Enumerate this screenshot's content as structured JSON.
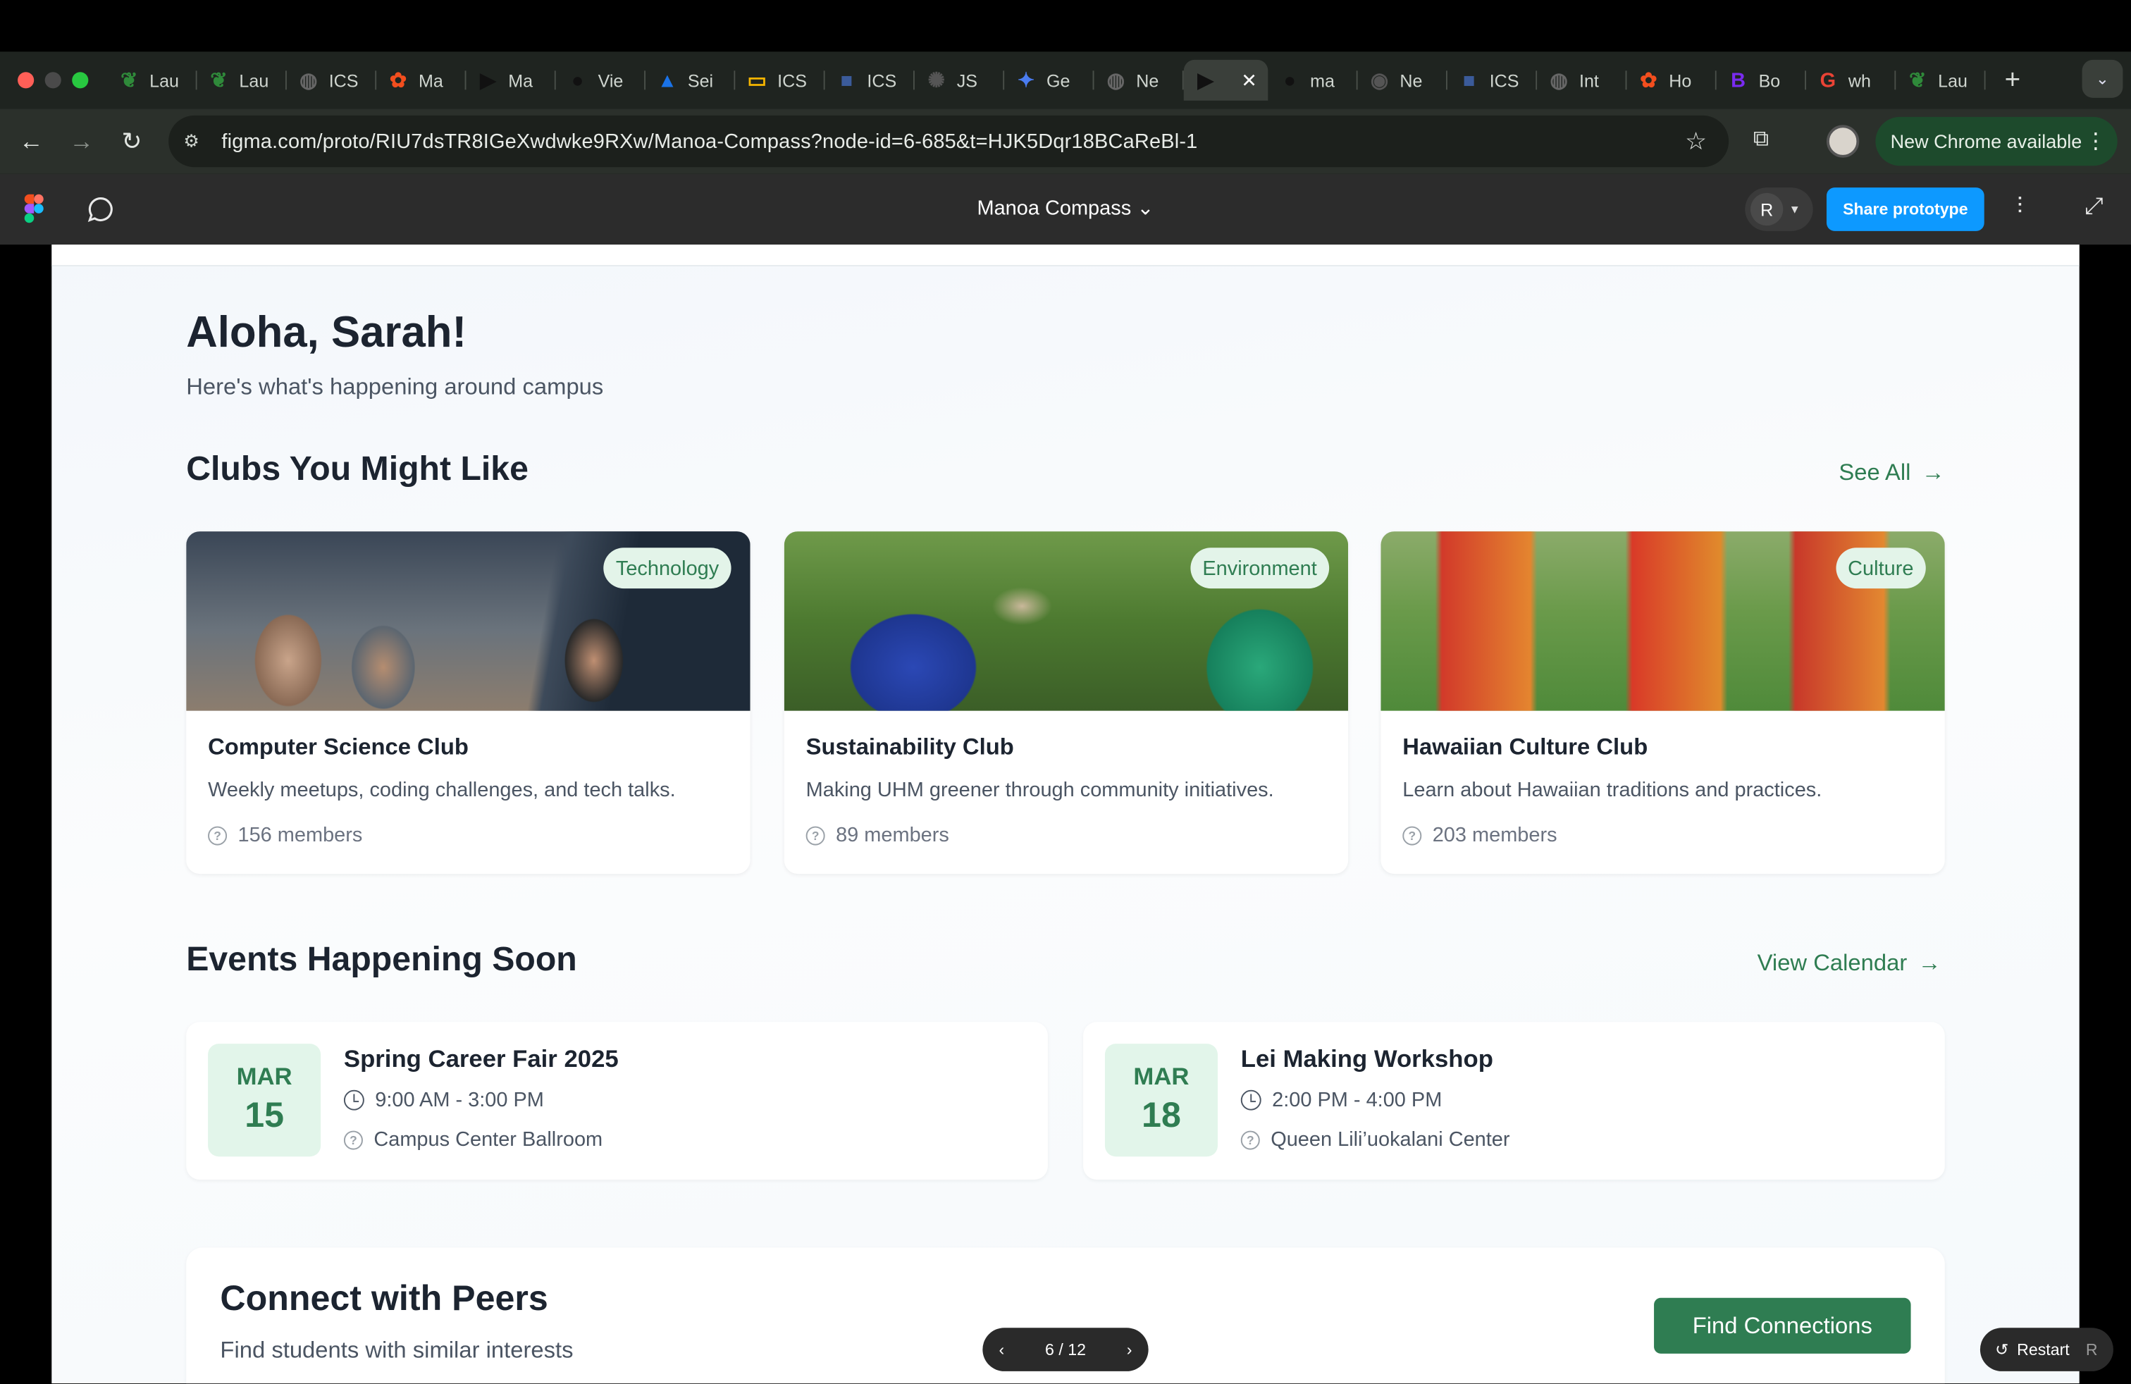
{
  "browser": {
    "tabs": [
      {
        "label": "Lau",
        "favicon": "leaf",
        "color": "#2f8a3a"
      },
      {
        "label": "Lau",
        "favicon": "leaf",
        "color": "#2f8a3a"
      },
      {
        "label": "ICS",
        "favicon": "globe",
        "color": "#666"
      },
      {
        "label": "Ma",
        "favicon": "figma",
        "color": "#f24e1e"
      },
      {
        "label": "Ma",
        "favicon": "play",
        "color": "#111"
      },
      {
        "label": "Vie",
        "favicon": "github",
        "color": "#111"
      },
      {
        "label": "Sei",
        "favicon": "drive",
        "color": "#1a73e8"
      },
      {
        "label": "ICS",
        "favicon": "slides",
        "color": "#f4b400"
      },
      {
        "label": "ICS",
        "favicon": "square",
        "color": "#3b5b9a"
      },
      {
        "label": "JS",
        "favicon": "openai",
        "color": "#555"
      },
      {
        "label": "Ge",
        "favicon": "gemini",
        "color": "#4a7cf0"
      },
      {
        "label": "Ne",
        "favicon": "globe",
        "color": "#666"
      },
      {
        "label": "",
        "favicon": "play",
        "color": "#111",
        "active": true
      },
      {
        "label": "ma",
        "favicon": "github",
        "color": "#111"
      },
      {
        "label": "Ne",
        "favicon": "chrome",
        "color": "#555"
      },
      {
        "label": "ICS",
        "favicon": "square",
        "color": "#3b5b9a"
      },
      {
        "label": "Int",
        "favicon": "globe",
        "color": "#666"
      },
      {
        "label": "Ho",
        "favicon": "figma",
        "color": "#f24e1e"
      },
      {
        "label": "Bo",
        "favicon": "bootstrap",
        "color": "#7a2bf0"
      },
      {
        "label": "wh",
        "favicon": "google",
        "color": "#ea4335"
      },
      {
        "label": "Lau",
        "favicon": "leaf",
        "color": "#2f8a3a"
      }
    ],
    "url": "figma.com/proto/RIU7dsTR8IGeXwdwke9RXw/Manoa-Compass?node-id=6-685&t=HJK5Dqr18BCaReBl-1",
    "new_chrome": "New Chrome available"
  },
  "figma": {
    "file_title": "Manoa Compass",
    "user_initial": "R",
    "share_label": "Share prototype",
    "pager": "6 / 12",
    "restart_label": "Restart",
    "restart_key": "R"
  },
  "page": {
    "greeting": "Aloha, Sarah!",
    "subtitle": "Here's what's happening around campus",
    "clubs_heading": "Clubs You Might Like",
    "see_all": "See All",
    "clubs": [
      {
        "tag": "Technology",
        "title": "Computer Science Club",
        "desc": "Weekly meetups, coding challenges, and tech talks.",
        "members": "156 members"
      },
      {
        "tag": "Environment",
        "title": "Sustainability Club",
        "desc": "Making UHM greener through community initiatives.",
        "members": "89 members"
      },
      {
        "tag": "Culture",
        "title": "Hawaiian Culture Club",
        "desc": "Learn about Hawaiian traditions and practices.",
        "members": "203 members"
      }
    ],
    "events_heading": "Events Happening Soon",
    "view_calendar": "View Calendar",
    "events": [
      {
        "month": "MAR",
        "day": "15",
        "title": "Spring Career Fair 2025",
        "time": "9:00 AM - 3:00 PM",
        "place": "Campus Center Ballroom"
      },
      {
        "month": "MAR",
        "day": "18",
        "title": "Lei Making Workshop",
        "time": "2:00 PM - 4:00 PM",
        "place": "Queen Lili’uokalani Center"
      }
    ],
    "peers_title": "Connect with Peers",
    "peers_sub": "Find students with similar interests",
    "find_connections": "Find Connections",
    "accent_color": "#2f7d52"
  }
}
